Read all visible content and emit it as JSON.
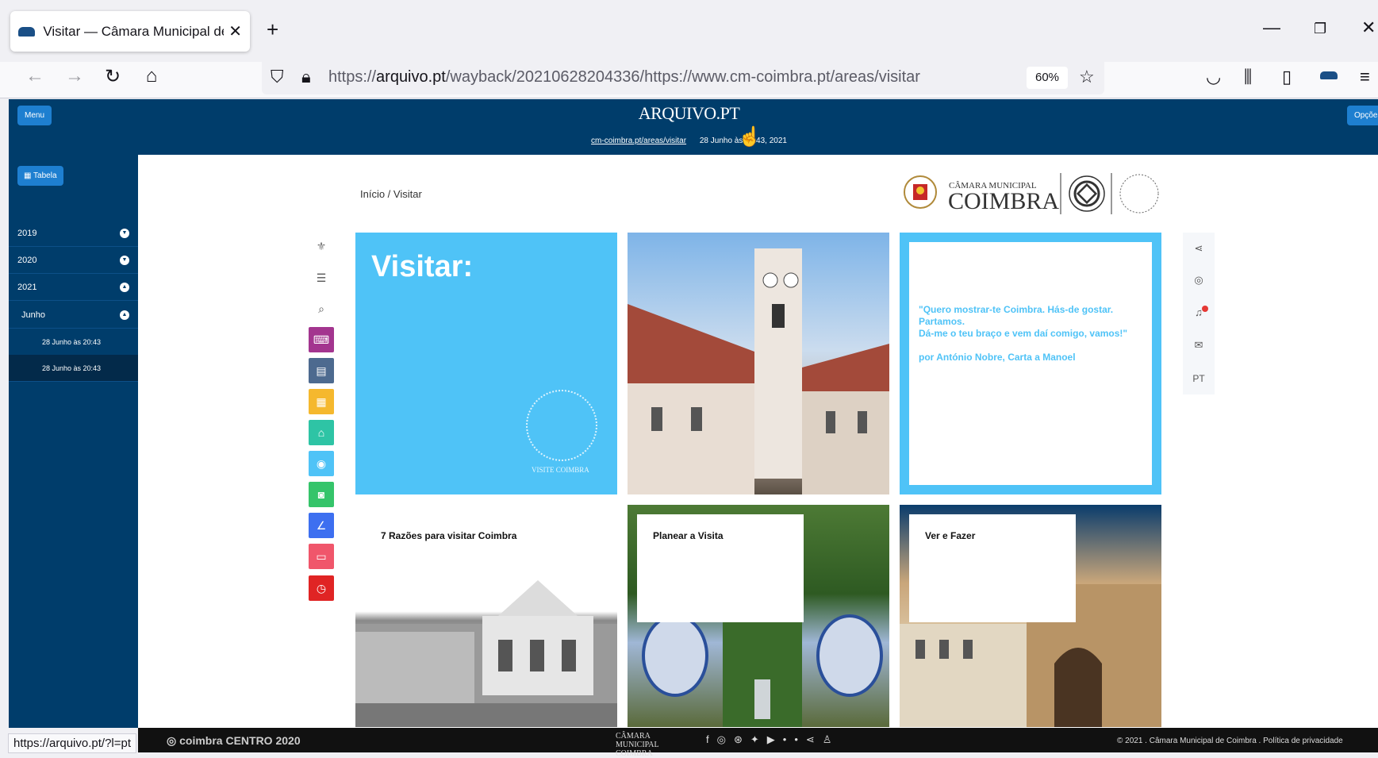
{
  "browser": {
    "tab_title": "Visitar — Câmara Municipal de Co",
    "url_host": "arquivo.pt",
    "url_prefix": "https://",
    "url_path": "/wayback/20210628204336/https://www.cm-coimbra.pt/areas/visitar",
    "zoom": "60%",
    "status_url": "https://arquivo.pt/?l=pt"
  },
  "arquivo": {
    "menu_label": "Menu",
    "options_label": "Opções",
    "logo_text": "ARQUIVO.PT",
    "archived_url": "cm-coimbra.pt/areas/visitar",
    "archived_date": "28 Junho às 20:43, 2021",
    "table_label": "▦ Tabela"
  },
  "sidebar": {
    "years": [
      {
        "label": "2019",
        "arrow": "▼"
      },
      {
        "label": "2020",
        "arrow": "▼"
      },
      {
        "label": "2021",
        "arrow": "▲"
      }
    ],
    "month": {
      "label": "Junho",
      "arrow": "▲"
    },
    "captures": [
      "28 Junho às 20:43",
      "28 Junho às 20:43"
    ]
  },
  "page": {
    "breadcrumb": "Início / Visitar",
    "logo_small": "CÂMARA MUNICIPAL",
    "logo_big": "COIMBRA",
    "hero_title": "Visitar:",
    "hero_seal_text": "VISITE COIMBRA",
    "quote_lines": [
      "\"Quero mostrar-te Coimbra. Hás-de gostar.",
      "Partamos.",
      "Dá-me o teu braço e vem daí comigo, vamos!\"",
      "",
      "por António Nobre, Carta a Manoel"
    ],
    "cards": [
      "7 Razões para visitar Coimbra",
      "Planear a Visita",
      "Ver e Fazer"
    ],
    "lang": "PT"
  },
  "footer": {
    "copyright": "© 2021 . Câmara Municipal de Coimbra . Política de privacidade",
    "logos": "◎ coimbra CENTRO 2020",
    "footer_logo": "CÂMARA MUNICIPAL COIMBRA"
  },
  "colors": {
    "arquivo_blue": "#003d6b",
    "button_blue": "#1e7fd0",
    "tile_cyan": "#4fc3f7"
  }
}
